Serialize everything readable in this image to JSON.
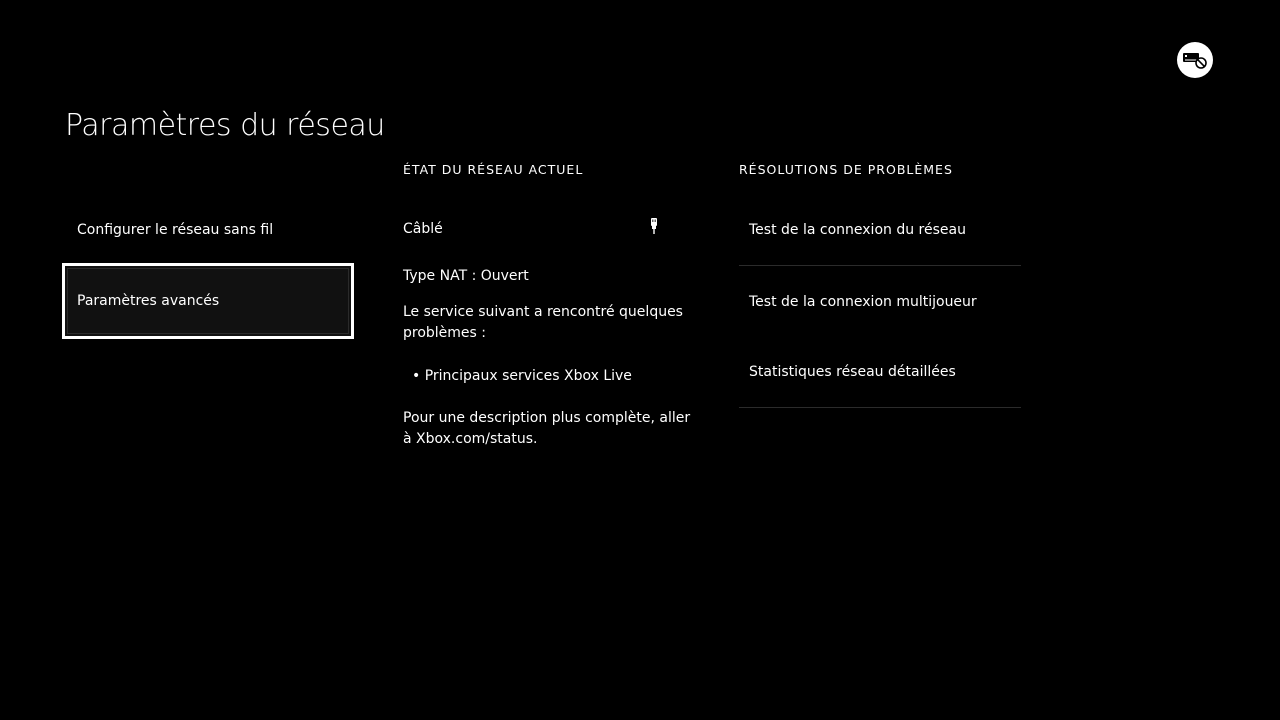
{
  "page": {
    "title": "Paramètres du réseau"
  },
  "system": {
    "status_icon": "network-disconnected-icon"
  },
  "menu": {
    "items": [
      {
        "label": "Configurer le réseau sans fil",
        "selected": false
      },
      {
        "label": "Paramètres avancés",
        "selected": true
      }
    ]
  },
  "network_status": {
    "header": "ÉTAT DU RÉSEAU ACTUEL",
    "connection": "Câblé",
    "connection_icon": "ethernet-icon",
    "nat": "Type NAT : Ouvert",
    "service_message": "Le service suivant a rencontré quelques problèmes :",
    "service_item": "• Principaux services Xbox Live",
    "description": "Pour une description plus complète, aller à Xbox.com/status."
  },
  "troubleshooting": {
    "header": "RÉSOLUTIONS DE PROBLÈMES",
    "items": [
      {
        "label": "Test de la connexion du réseau"
      },
      {
        "label": "Test de la connexion multijoueur"
      },
      {
        "label": "Statistiques réseau détaillées"
      }
    ]
  },
  "colors": {
    "background": "#000000",
    "text": "#ffffff",
    "selected_border": "#ffffff",
    "divider": "#2b2b2b"
  }
}
